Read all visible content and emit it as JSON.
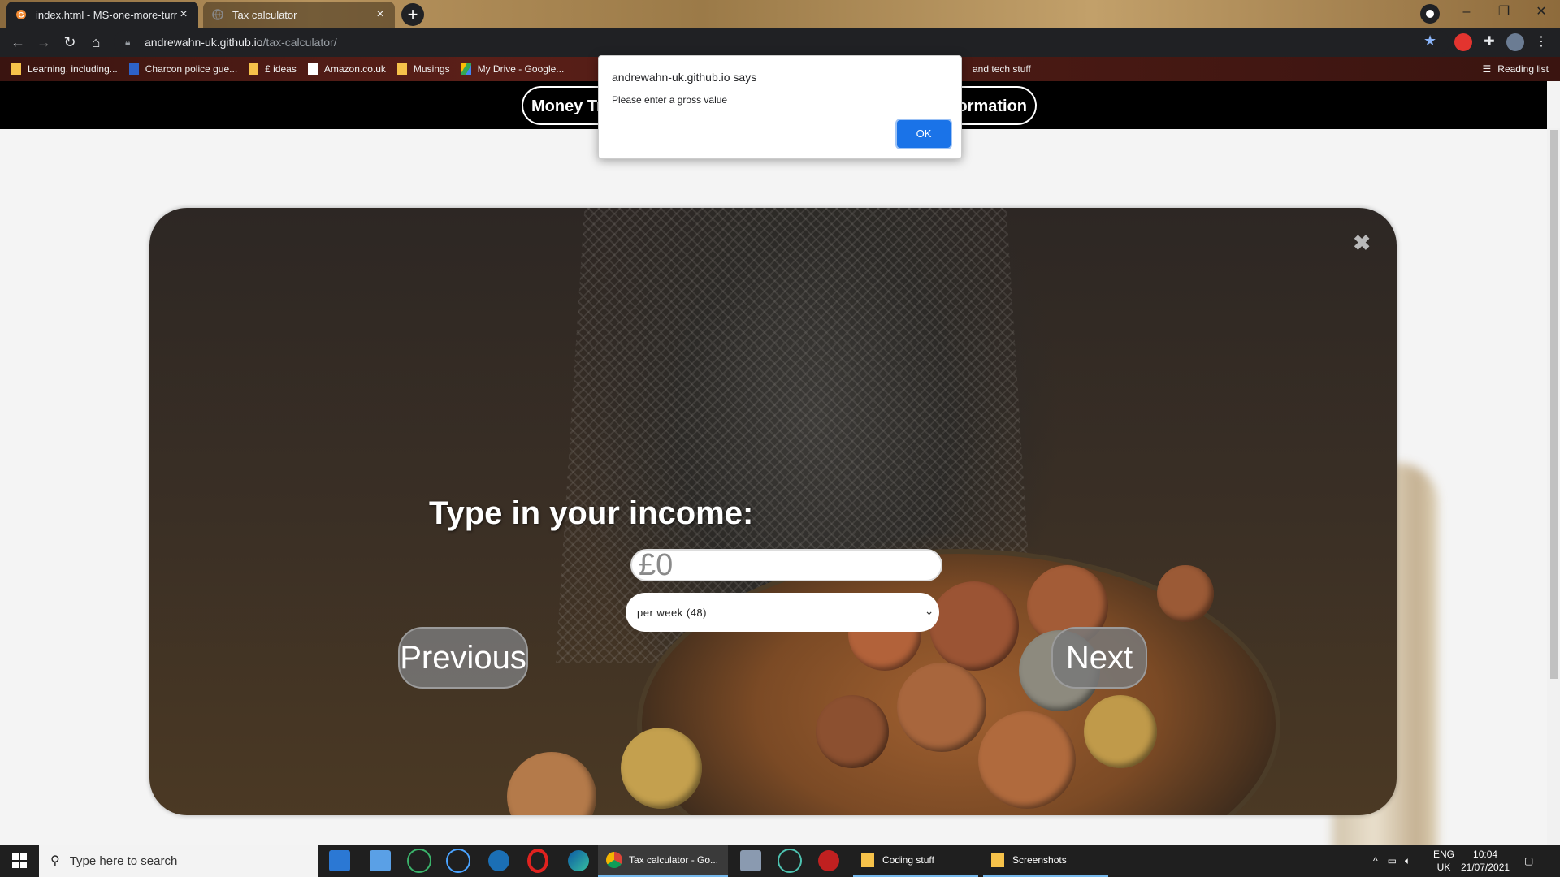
{
  "browser": {
    "tabs": [
      {
        "label": "index.html - MS-one-more-turn",
        "active": true
      },
      {
        "label": "Tax calculator",
        "active": false
      }
    ],
    "new_tab": "+",
    "url_host": "andrewahn-uk.github.io",
    "url_path": "/tax-calculator/",
    "bookmarks": [
      "Learning, including...",
      "Charcon police gue...",
      "£ ideas",
      "Amazon.co.uk",
      "Musings",
      "My Drive - Google...",
      "and tech stuff"
    ],
    "reading_list": "Reading list"
  },
  "site_nav": {
    "left_pill": "Money Tr",
    "right_pill": "formation"
  },
  "form": {
    "prompt": "Type in your income:",
    "income_placeholder": "£0",
    "period_selected": "per week (48)",
    "previous_label": "Previous",
    "next_label": "Next",
    "close_glyph": "✖"
  },
  "alert": {
    "origin": "andrewahn-uk.github.io says",
    "message": "Please enter a gross value",
    "ok_label": "OK"
  },
  "taskbar": {
    "search_placeholder": "Type here to search",
    "apps": [
      {
        "label": "Tax calculator - Go..."
      },
      {
        "label": "Coding stuff"
      },
      {
        "label": "Screenshots"
      }
    ],
    "lang_top": "ENG",
    "lang_bottom": "UK",
    "time": "10:04",
    "date": "21/07/2021"
  },
  "colors": {
    "accent": "#1a73e8",
    "browser_dark": "#202124",
    "bookmark_folder": "#f6c24a"
  }
}
